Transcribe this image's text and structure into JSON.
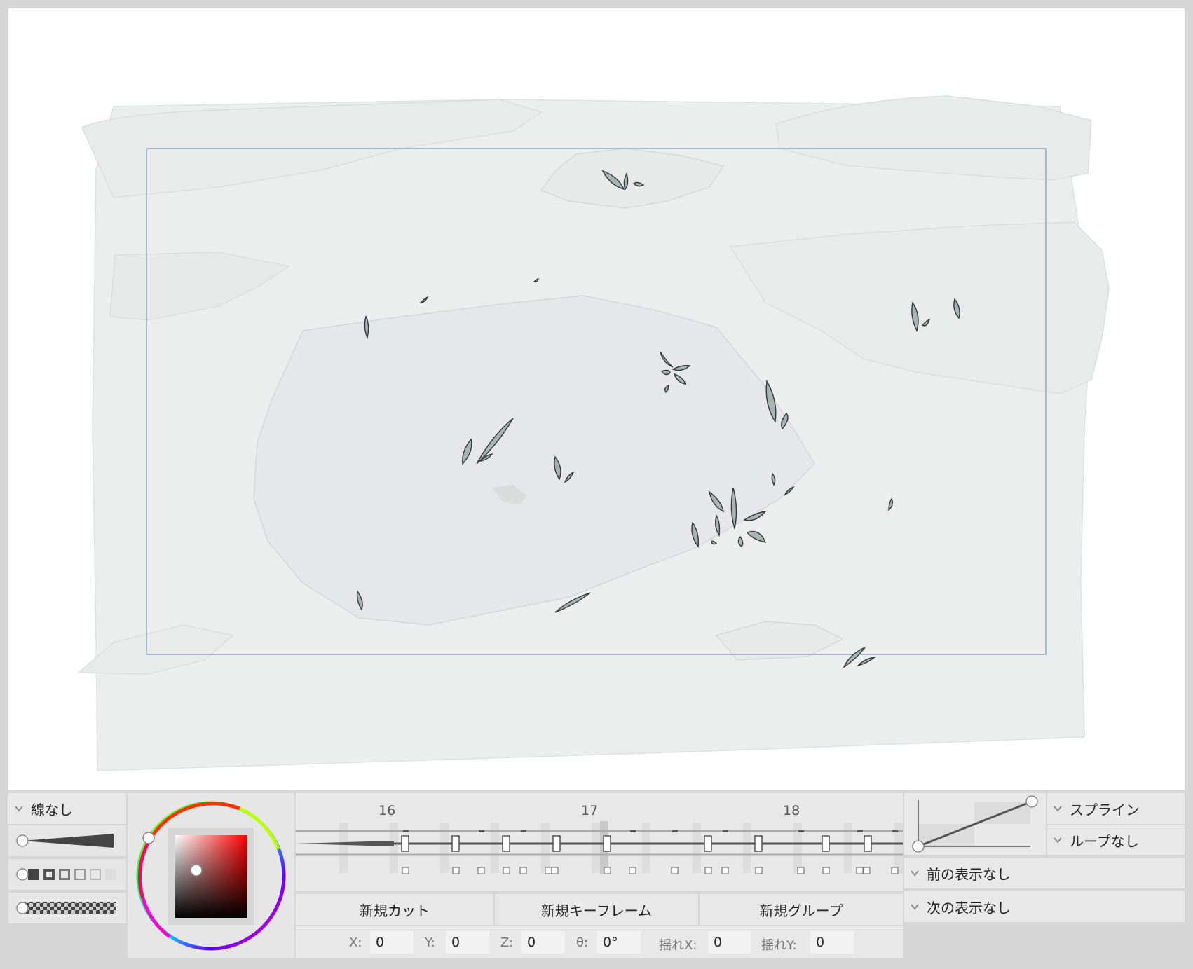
{
  "canvas": {
    "background": "#ffffff",
    "artwork_color": "#eceded",
    "frame_color": "#8fa8c8",
    "leaf_fill": "#a9b3b2",
    "leaf_stroke": "#2e3838"
  },
  "stroke_panel": {
    "line_mode": "線なし",
    "width_slider_icon": "taper-brush-icon",
    "shape_icons": "square-shapes-icon",
    "texture_icon": "checker-texture-icon"
  },
  "color_picker": {
    "ring": "hue-wheel",
    "selected_color": "#e4a0a0"
  },
  "timeline": {
    "frame_labels": [
      "16",
      "17",
      "18"
    ]
  },
  "actions": {
    "new_cut": "新規カット",
    "new_keyframe": "新規キーフレーム",
    "new_group": "新規グループ"
  },
  "coords": {
    "x_label": "X:",
    "x_value": "0",
    "y_label": "Y:",
    "y_value": "0",
    "z_label": "Z:",
    "z_value": "0",
    "theta_label": "θ:",
    "theta_value": "0°",
    "shake_x_label": "揺れX:",
    "shake_x_value": "0",
    "shake_y_label": "揺れY:",
    "shake_y_value": "0"
  },
  "interpolation": {
    "curve_icon": "easing-curve-icon",
    "mode": "スプライン",
    "loop": "ループなし"
  },
  "onion_skin": {
    "prev": "前の表示なし",
    "next": "次の表示なし"
  }
}
